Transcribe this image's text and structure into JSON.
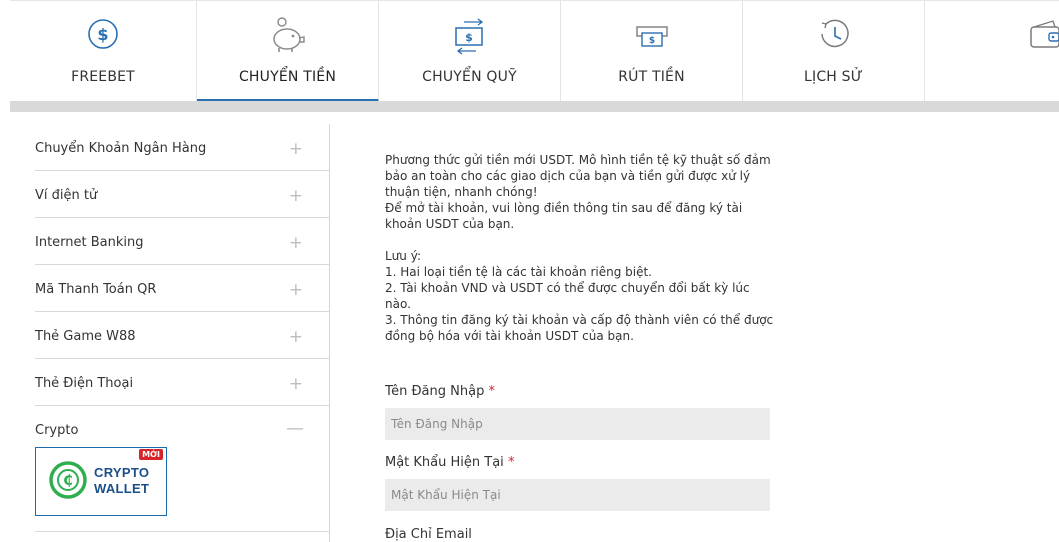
{
  "tabs": [
    {
      "label": "FREEBET",
      "icon": "dollar-circle-icon",
      "active": false
    },
    {
      "label": "CHUYỂN TIỀN",
      "icon": "piggy-bank-icon",
      "active": true
    },
    {
      "label": "CHUYỂN QUỸ",
      "icon": "transfer-money-icon",
      "active": false
    },
    {
      "label": "RÚT TIỀN",
      "icon": "withdraw-cash-icon",
      "active": false
    },
    {
      "label": "LỊCH SỬ",
      "icon": "history-clock-icon",
      "active": false
    },
    {
      "label": "",
      "icon": "wallet-icon",
      "active": false
    }
  ],
  "sidebar": {
    "items": [
      {
        "label": "Chuyển Khoản Ngân Hàng"
      },
      {
        "label": "Ví điện tử"
      },
      {
        "label": "Internet Banking"
      },
      {
        "label": "Mã Thanh Toán QR"
      },
      {
        "label": "Thẻ Game W88"
      },
      {
        "label": "Thẻ Điện Thoại"
      }
    ],
    "crypto": {
      "label": "Crypto",
      "wallet_line1": "CRYPTO",
      "wallet_line2": "WALLET",
      "new_badge": "MỚI"
    }
  },
  "main": {
    "intro": [
      "Phương thức gửi tiền mới USDT. Mô hình tiền tệ kỹ thuật số đảm bảo an toàn cho các giao dịch của bạn và tiền gửi được xử lý thuận tiện, nhanh chóng!",
      "Để mở tài khoản, vui lòng điền thông tin sau để đăng ký tài khoản USDT của bạn."
    ],
    "note_title": "Lưu ý:",
    "notes": [
      "1. Hai loại tiền tệ là các tài khoản riêng biệt.",
      "2. Tài khoản VND và USDT có thể được chuyển đổi bất kỳ lúc nào.",
      "3. Thông tin đăng ký tài khoản và cấp độ thành viên có thể được đồng bộ hóa với tài khoản USDT của bạn."
    ],
    "form": {
      "username_label": "Tên Đăng Nhập",
      "username_placeholder": "Tên Đăng Nhập",
      "password_label": "Mật Khẩu Hiện Tại",
      "password_placeholder": "Mật Khẩu Hiện Tại",
      "email_label": "Địa Chỉ Email",
      "required_mark": "*"
    }
  },
  "colors": {
    "accent": "#2a6fb0",
    "required": "#d8232a",
    "input_bg": "#ebebeb"
  }
}
